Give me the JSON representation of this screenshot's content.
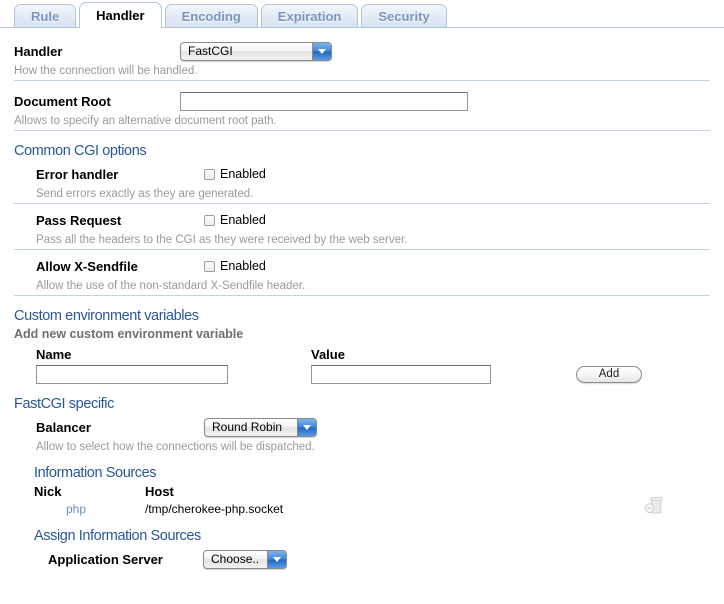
{
  "tabs": [
    {
      "label": "Rule",
      "active": false
    },
    {
      "label": "Handler",
      "active": true
    },
    {
      "label": "Encoding",
      "active": false
    },
    {
      "label": "Expiration",
      "active": false
    },
    {
      "label": "Security",
      "active": false
    }
  ],
  "handler": {
    "label": "Handler",
    "value": "FastCGI",
    "help": "How the connection will be handled."
  },
  "document_root": {
    "label": "Document Root",
    "value": "",
    "placeholder": "",
    "help": "Allows to specify an alternative document root path."
  },
  "common_cgi": {
    "heading": "Common CGI options",
    "options": [
      {
        "label": "Error handler",
        "checkbox_label": "Enabled",
        "checked": false,
        "help": "Send errors exactly as they are generated."
      },
      {
        "label": "Pass Request",
        "checkbox_label": "Enabled",
        "checked": false,
        "help": "Pass all the headers to the CGI as they were received by the web server."
      },
      {
        "label": "Allow X-Sendfile",
        "checkbox_label": "Enabled",
        "checked": false,
        "help": "Allow the use of the non-standard X-Sendfile header."
      }
    ]
  },
  "custom_env": {
    "heading": "Custom environment variables",
    "subheading": "Add new custom environment variable",
    "col_name": "Name",
    "col_value": "Value",
    "name_value": "",
    "value_value": "",
    "add_label": "Add"
  },
  "fastcgi": {
    "heading": "FastCGI specific",
    "balancer_label": "Balancer",
    "balancer_value": "Round Robin",
    "balancer_help": "Allow to select how the connections will be dispatched.",
    "info_sources_heading": "Information Sources",
    "col_nick": "Nick",
    "col_host": "Host",
    "sources": [
      {
        "nick": "php",
        "host": "/tmp/cherokee-php.socket"
      }
    ],
    "assign_heading": "Assign Information Sources",
    "app_server_label": "Application Server",
    "app_server_value": "Choose.."
  },
  "icons": {
    "dropdown": "chevron-down-icon",
    "trash": "trash-icon"
  },
  "colors": {
    "section_heading": "#2b5797",
    "tab_inactive_text": "#7b95bd",
    "link": "#6a8dc0",
    "help_text": "#9a9a9a",
    "rule": "#c3d2e6"
  }
}
